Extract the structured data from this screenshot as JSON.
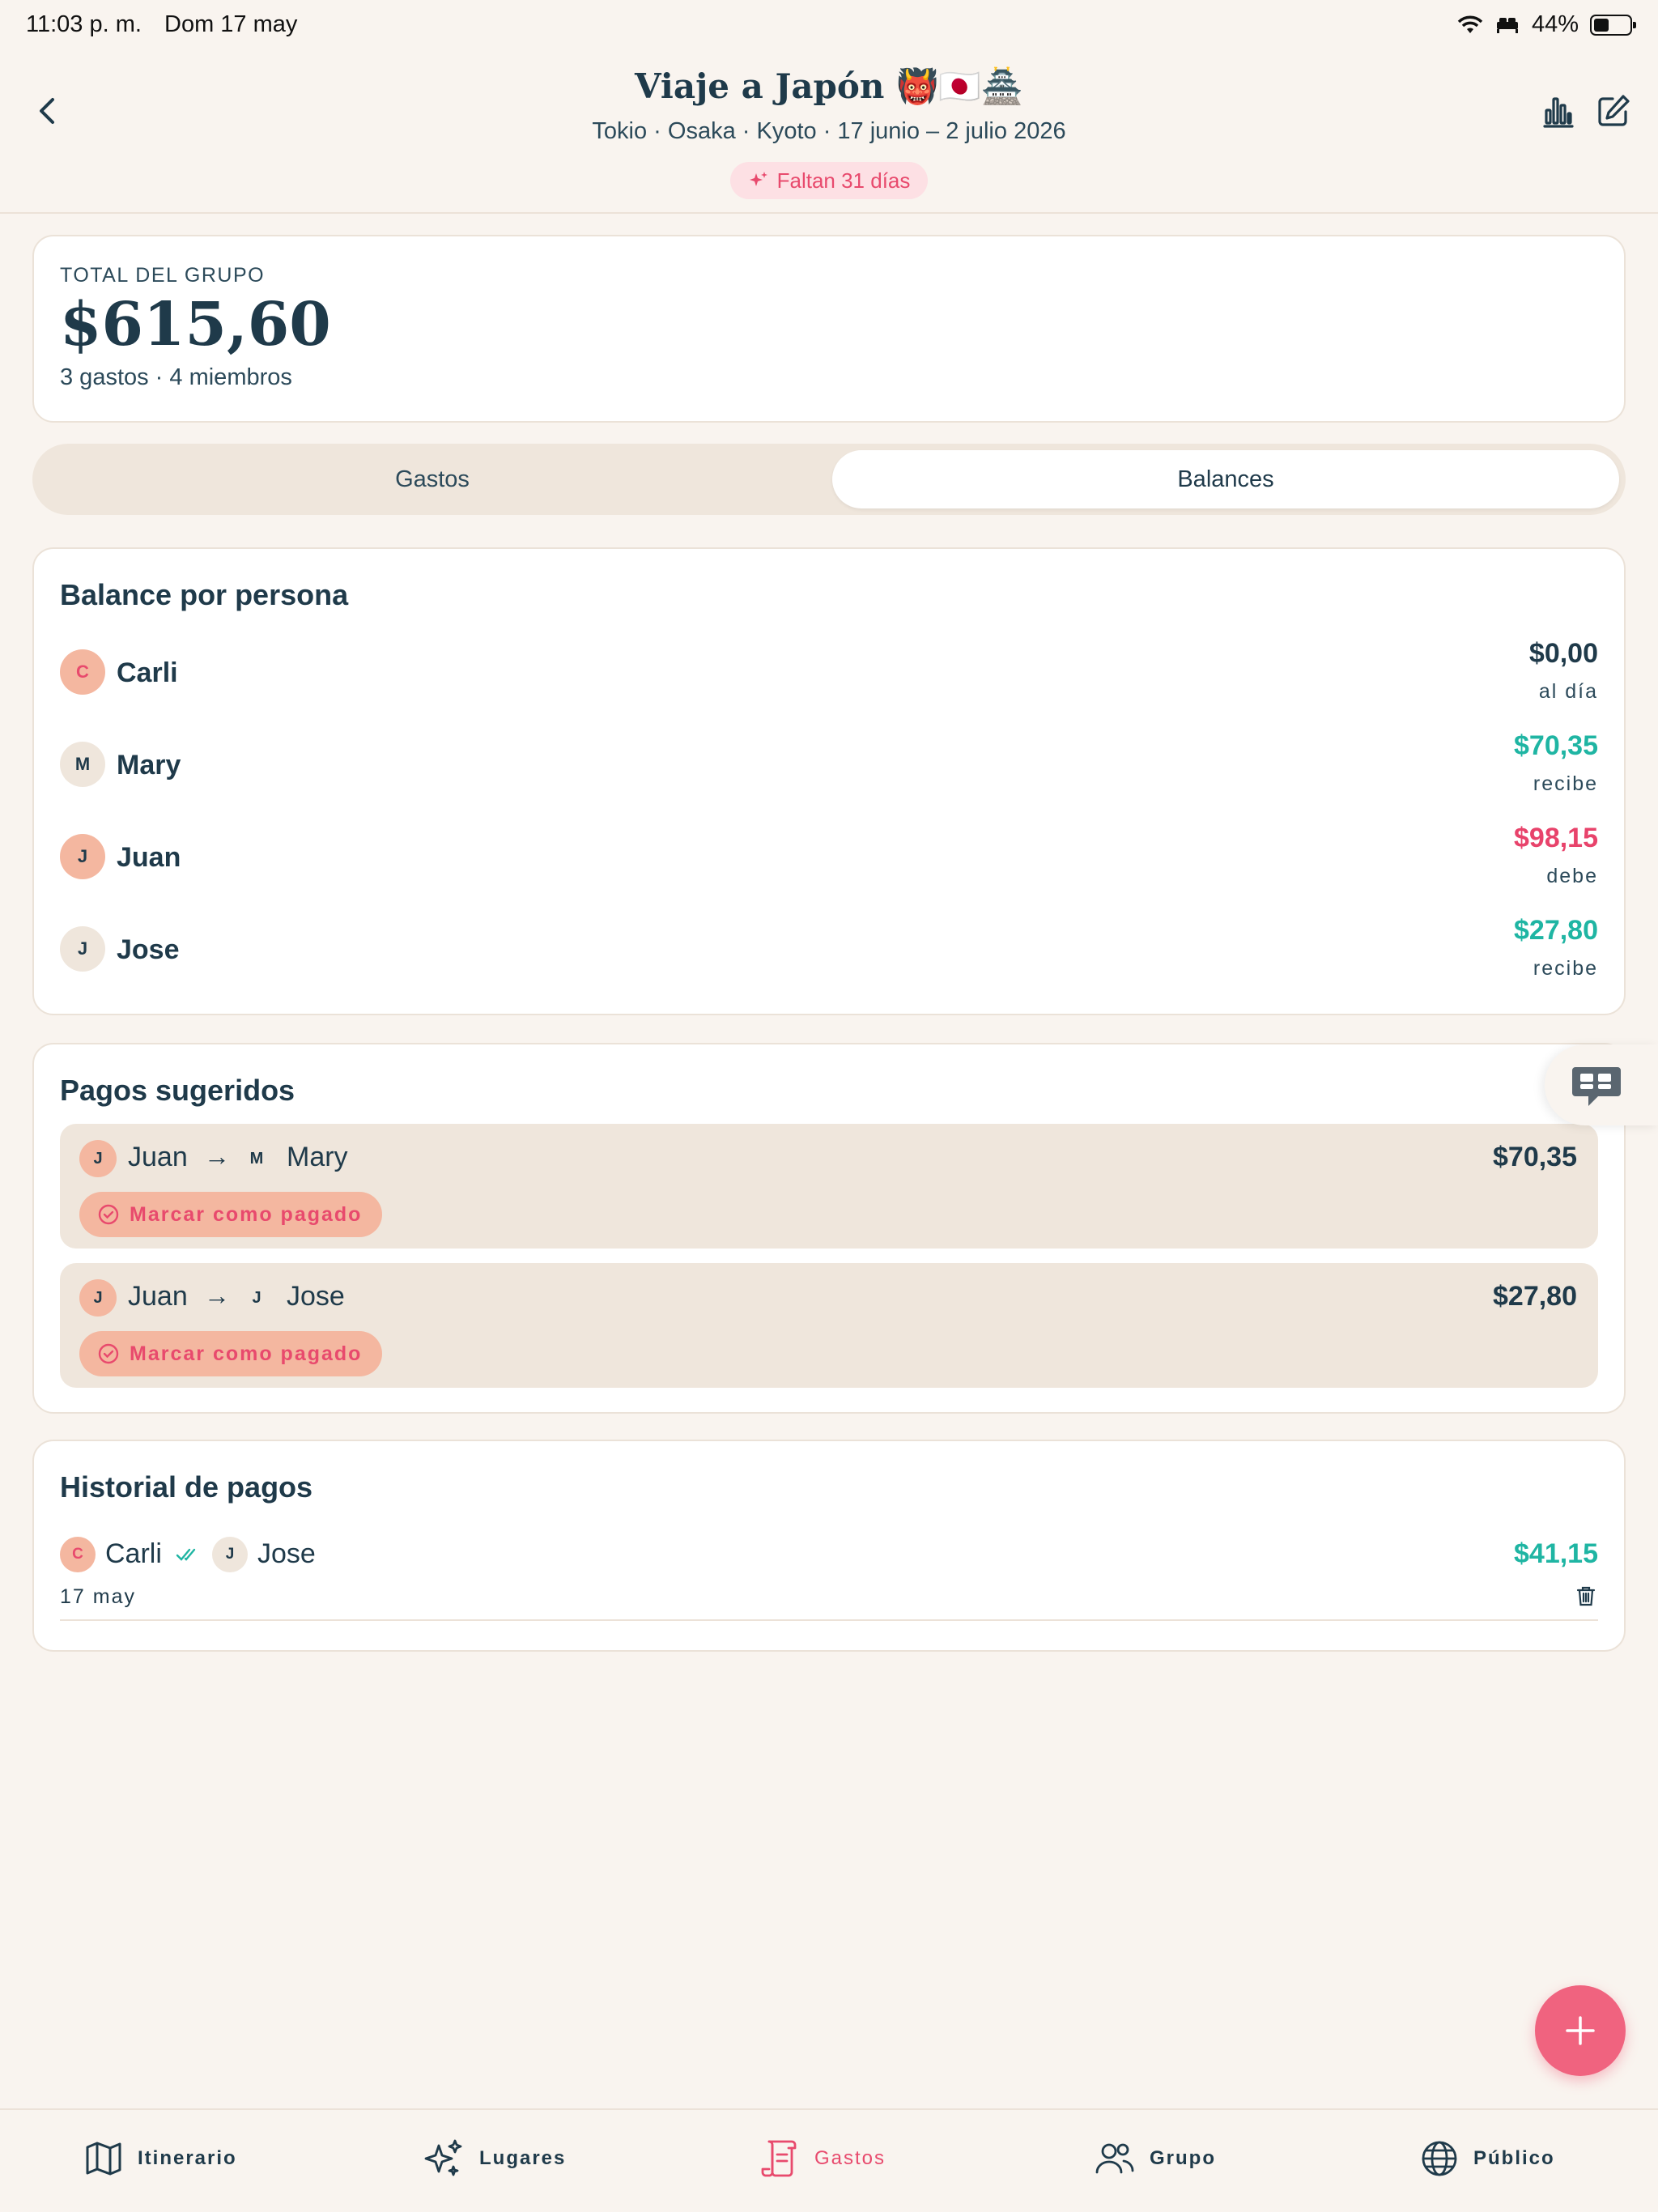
{
  "status_bar": {
    "time": "11:03 p. m.",
    "date": "Dom 17 may",
    "battery": "44%"
  },
  "header": {
    "title": "Viaje a Japón 👹🇯🇵🏯",
    "subtitle": "Tokio · Osaka · Kyoto · 17 junio – 2 julio 2026",
    "countdown": "Faltan 31 días"
  },
  "total": {
    "label": "TOTAL DEL GRUPO",
    "amount": "$615,60",
    "sub": "3 gastos · 4 miembros"
  },
  "segment": {
    "tab1": "Gastos",
    "tab2": "Balances",
    "active": "Balances"
  },
  "balances": {
    "title": "Balance por persona",
    "rows": [
      {
        "initial": "C",
        "name": "Carli",
        "amount": "$0,00",
        "state": "al día"
      },
      {
        "initial": "M",
        "name": "Mary",
        "amount": "$70,35",
        "state": "recibe"
      },
      {
        "initial": "J",
        "name": "Juan",
        "amount": "$98,15",
        "state": "debe"
      },
      {
        "initial": "J",
        "name": "Jose",
        "amount": "$27,80",
        "state": "recibe"
      }
    ]
  },
  "suggested": {
    "title": "Pagos sugeridos",
    "mark_label": "Marcar como pagado",
    "payments": [
      {
        "from_initial": "J",
        "from": "Juan",
        "arrow": "→",
        "to_initial": "M",
        "to": "Mary",
        "amount": "$70,35"
      },
      {
        "from_initial": "J",
        "from": "Juan",
        "arrow": "→",
        "to_initial": "J",
        "to": "Jose",
        "amount": "$27,80"
      }
    ]
  },
  "history": {
    "title": "Historial de pagos",
    "entries": [
      {
        "from_initial": "C",
        "from": "Carli",
        "to_initial": "J",
        "to": "Jose",
        "amount": "$41,15",
        "date": "17 may"
      }
    ]
  },
  "tabs": {
    "items": [
      {
        "label": "Itinerario",
        "icon": "map-icon"
      },
      {
        "label": "Lugares",
        "icon": "sparkles-icon"
      },
      {
        "label": "Gastos",
        "icon": "receipt-icon"
      },
      {
        "label": "Grupo",
        "icon": "users-icon"
      },
      {
        "label": "Público",
        "icon": "globe-icon"
      }
    ],
    "active": "Gastos"
  },
  "colors": {
    "accent": "#e84a6d",
    "positive": "#1fb5a3",
    "negative": "#e8436b",
    "text": "#1f3a4a",
    "background": "#f9f4ef"
  }
}
